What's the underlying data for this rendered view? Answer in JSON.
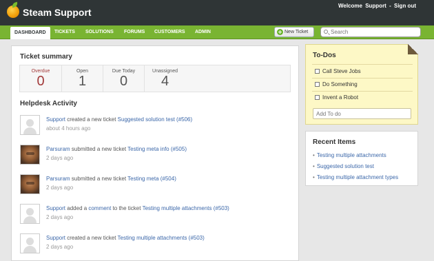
{
  "app": {
    "name": "Steam Support"
  },
  "userbar": {
    "welcome": "Welcome",
    "username": "Support",
    "separator": "-",
    "signout": "Sign out"
  },
  "nav": {
    "items": [
      {
        "label": "DASHBOARD",
        "active": true
      },
      {
        "label": "TICKETS"
      },
      {
        "label": "SOLUTIONS"
      },
      {
        "label": "FORUMS"
      },
      {
        "label": "CUSTOMERS"
      },
      {
        "label": "ADMIN"
      }
    ],
    "new_ticket": "New Ticket",
    "search_placeholder": "Search"
  },
  "summary": {
    "title": "Ticket summary",
    "stats": [
      {
        "label": "Overdue",
        "value": "0"
      },
      {
        "label": "Open",
        "value": "1"
      },
      {
        "label": "Due Today",
        "value": "0"
      },
      {
        "label": "Unassigned",
        "value": "4"
      }
    ]
  },
  "activity": {
    "title": "Helpdesk Activity",
    "items": [
      {
        "user": "Support",
        "action": "created a new ticket",
        "link": "Suggested solution test (#506)",
        "time": "about 4 hours ago",
        "avatar": "default"
      },
      {
        "user": "Parsuram",
        "action": "submitted a new ticket",
        "link": "Testing meta info (#505)",
        "time": "2 days ago",
        "avatar": "photo"
      },
      {
        "user": "Parsuram",
        "action": "submitted a new ticket",
        "link": "Testing meta (#504)",
        "time": "2 days ago",
        "avatar": "photo"
      },
      {
        "user": "Support",
        "action": "added a",
        "comment": "comment",
        "action2": "to the ticket",
        "link": "Testing multiple attachments (#503)",
        "time": "2 days ago",
        "avatar": "default"
      },
      {
        "user": "Support",
        "action": "created a new ticket",
        "link": "Testing multiple attachments (#503)",
        "time": "2 days ago",
        "avatar": "default"
      }
    ]
  },
  "todos": {
    "title": "To-Dos",
    "items": [
      "Call Steve Jobs",
      "Do Something",
      "Invent a Robot"
    ],
    "add_placeholder": "Add To do"
  },
  "recent": {
    "title": "Recent Items",
    "items": [
      "Testing multiple attachments",
      "Suggested solution test",
      "Testing multiple attachment types"
    ]
  },
  "colors": {
    "header": "#2f3536",
    "nav": "#79b432",
    "link": "#3b67a9",
    "overdue": "#a23a3a",
    "todo_bg": "#fdf8c6"
  }
}
